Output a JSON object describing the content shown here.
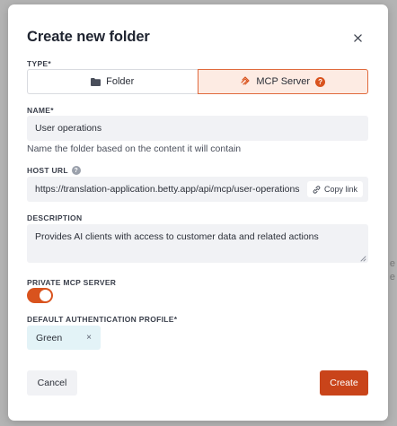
{
  "modal": {
    "title": "Create new folder",
    "type_label": "TYPE*",
    "type_options": [
      "Folder",
      "MCP Server"
    ],
    "type_selected": "MCP Server",
    "name_label": "NAME*",
    "name_value": "User operations",
    "name_hint": "Name the folder based on the content it will contain",
    "host_label": "HOST URL",
    "host_value": "https://translation-application.betty.app/api/mcp/user-operations",
    "copy_label": "Copy link",
    "description_label": "DESCRIPTION",
    "description_value": "Provides AI clients with access to customer data and related actions",
    "private_label": "PRIVATE MCP SERVER",
    "private_enabled": true,
    "auth_label": "DEFAULT AUTHENTICATION PROFILE*",
    "auth_value": "Green",
    "cancel_label": "Cancel",
    "create_label": "Create",
    "help_glyph": "?",
    "chip_remove_glyph": "×"
  },
  "backdrop": {
    "fragment_1": "e",
    "fragment_2": "e"
  },
  "colors": {
    "accent": "#d9531e",
    "create_button": "#c9441a",
    "selected_type_bg": "#fdebe3",
    "input_bg": "#f1f2f5",
    "chip_bg": "#e3f3f7"
  },
  "icons": {
    "close": "close-icon",
    "folder": "folder-icon",
    "mcp": "mcp-server-icon",
    "help": "help-icon",
    "link": "link-icon"
  }
}
